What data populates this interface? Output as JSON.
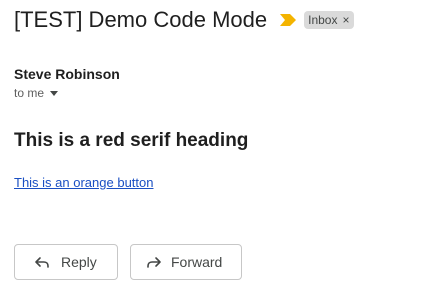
{
  "email": {
    "subject": "[TEST] Demo Code Mode",
    "label": "Inbox",
    "label_remove_glyph": "×",
    "importance_icon": "importance-marker-icon",
    "importance_color": "#f4b400",
    "sender_name": "Steve Robinson",
    "recipient_text": "to me"
  },
  "body": {
    "heading": "This is a red serif heading",
    "link_text": "This is an orange button"
  },
  "actions": {
    "reply_label": "Reply",
    "forward_label": "Forward",
    "reply_icon": "reply-arrow-icon",
    "forward_icon": "forward-arrow-icon"
  },
  "colors": {
    "link": "#1a4fc3",
    "label_chip_bg": "#dadada"
  }
}
